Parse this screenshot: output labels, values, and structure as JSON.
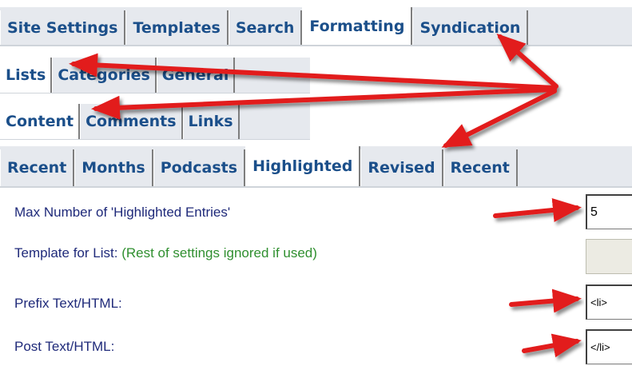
{
  "tabs_row1": [
    {
      "label": "Site Settings"
    },
    {
      "label": "Templates"
    },
    {
      "label": "Search"
    },
    {
      "label": "Formatting",
      "active": true
    },
    {
      "label": "Syndication"
    }
  ],
  "tabs_row2": [
    {
      "label": "Lists",
      "active": true
    },
    {
      "label": "Categories"
    },
    {
      "label": "General"
    }
  ],
  "tabs_row3": [
    {
      "label": "Content",
      "active": true
    },
    {
      "label": "Comments"
    },
    {
      "label": "Links"
    }
  ],
  "tabs_row4": [
    {
      "label": "Recent"
    },
    {
      "label": "Months"
    },
    {
      "label": "Podcasts"
    },
    {
      "label": "Highlighted",
      "active": true
    },
    {
      "label": "Revised"
    },
    {
      "label": "Recent"
    }
  ],
  "settings": {
    "max_entries": {
      "label": "Max Number of 'Highlighted Entries'",
      "value": "5"
    },
    "template_list": {
      "label": "Template for List:",
      "hint": "(Rest of settings ignored if used)",
      "value": ""
    },
    "prefix": {
      "label": "Prefix Text/HTML:",
      "value": "<li>"
    },
    "post": {
      "label": "Post Text/HTML:",
      "value": "</li>"
    }
  },
  "colors": {
    "tab_text": "#1b4f8a",
    "label_text": "#1f2a7a",
    "hint_text": "#2f8f2f",
    "annotation_arrow": "#e21b1b"
  }
}
